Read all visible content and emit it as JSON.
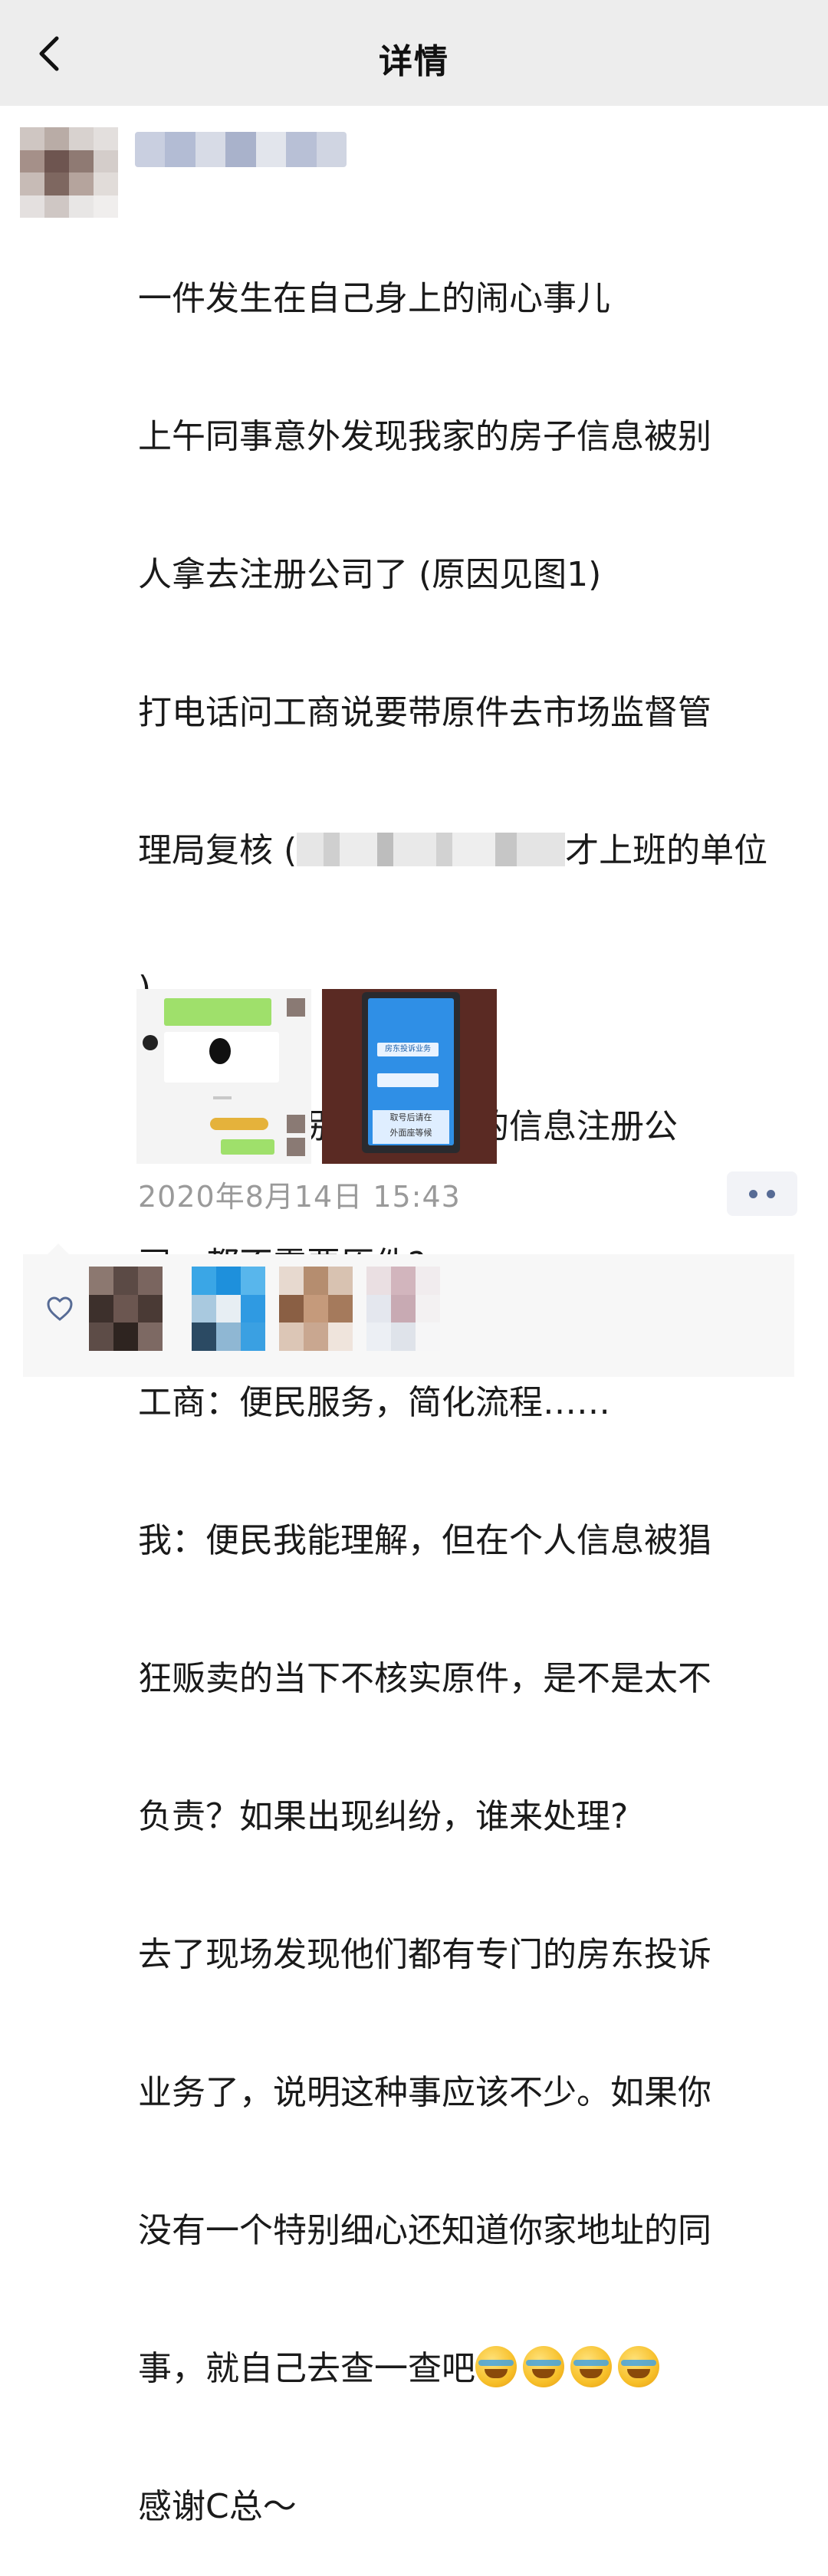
{
  "nav": {
    "title": "详情",
    "back_icon": "chevron-left-icon"
  },
  "post": {
    "lines": [
      "一件发生在自己身上的闹心事儿",
      "上午同事意外发现我家的房子信息被别",
      "人拿去注册公司了 (原因见图1)",
      "打电话问工商说要带原件去市场监督管",
      "理局复核 (",
      "才上班的单位",
      ")",
      "问到为什么别人拿我们的信息注册公",
      "司，都不需要原件?",
      "工商：便民服务，简化流程……",
      "我：便民我能理解，但在个人信息被猖",
      "狂贩卖的当下不核实原件，是不是太不",
      "负责？如果出现纠纷，谁来处理?",
      "去了现场发现他们都有专门的房东投诉",
      "业务了，说明这种事应该不少。如果你",
      "没有一个特别细心还知道你家地址的同",
      "事，就自己去查一查吧",
      "感谢C总～"
    ],
    "emoji_name": "crying-laughing-emoji",
    "timestamp": "2020年8月14日 15:43"
  },
  "thumb2": {
    "screen_lines": [
      "房东投诉业务",
      "取号后请在",
      "外面座等候"
    ]
  },
  "colors": {
    "nav_bg": "#ededed",
    "link_blue": "#576b95",
    "time_gray": "#9a9a9a",
    "likes_bg": "#f7f7f7"
  }
}
